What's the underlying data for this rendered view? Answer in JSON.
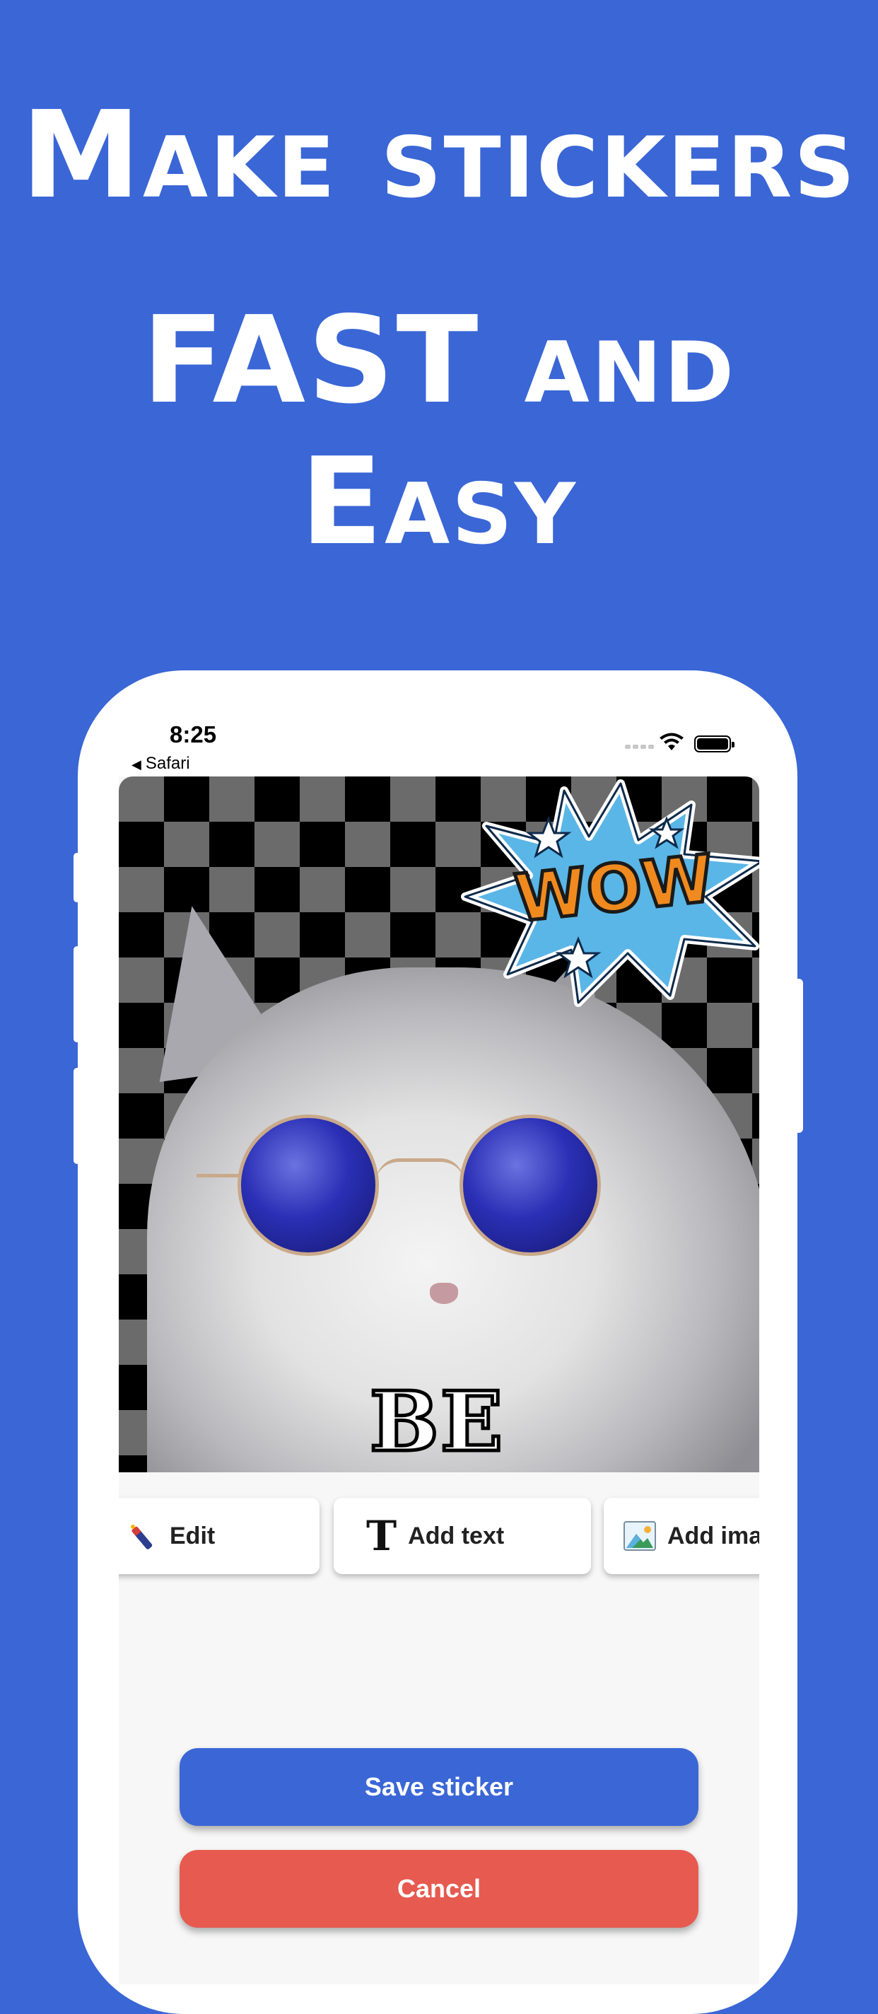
{
  "headline": {
    "line1": "Make stickers",
    "line2": "FAST and Easy"
  },
  "status_bar": {
    "time": "8:25",
    "back_label": "Safari"
  },
  "canvas": {
    "wow_text": "WOW",
    "caption": "BE COOL"
  },
  "toolbar": {
    "edit_label": "Edit",
    "add_text_label": "Add text",
    "add_image_label": "Add ima"
  },
  "actions": {
    "save_label": "Save sticker",
    "cancel_label": "Cancel"
  },
  "colors": {
    "background": "#3a66d6",
    "save": "#3a66d6",
    "cancel": "#e65a4f"
  }
}
